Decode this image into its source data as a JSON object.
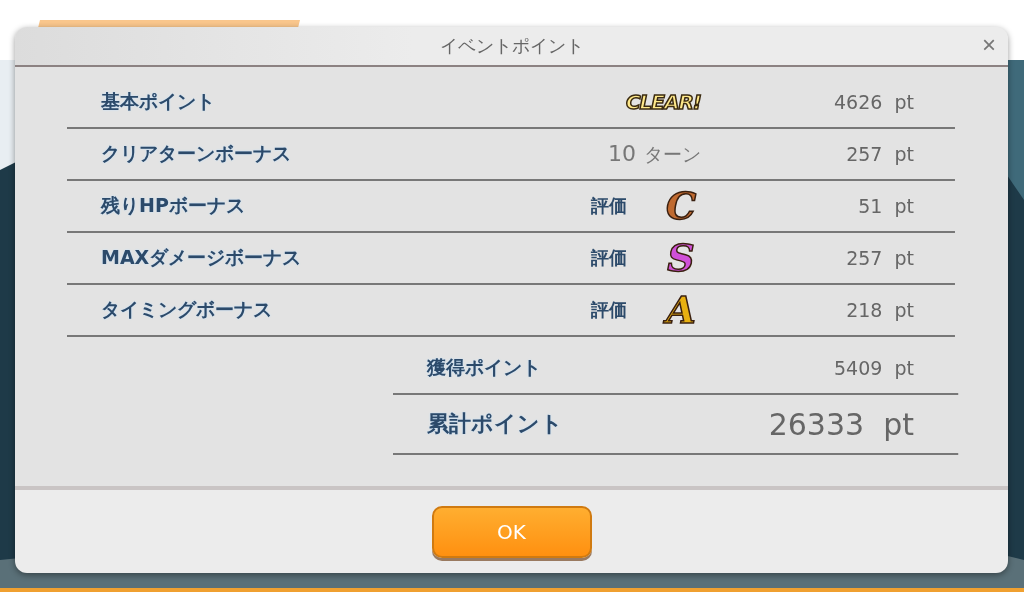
{
  "dialog": {
    "title": "イベントポイント",
    "close": "×"
  },
  "rows": [
    {
      "label": "基本ポイント",
      "kind": "badge",
      "badge": "CLEAR!",
      "points": "4626",
      "unit": "pt"
    },
    {
      "label": "クリアターンボーナス",
      "kind": "turns",
      "turns": "10",
      "turns_unit": "ターン",
      "points": "257",
      "unit": "pt"
    },
    {
      "label": "残りHPボーナス",
      "kind": "grade",
      "grade_label": "評価",
      "grade": "C",
      "color": "#c06a30",
      "points": "51",
      "unit": "pt"
    },
    {
      "label": "MAXダメージボーナス",
      "kind": "grade",
      "grade_label": "評価",
      "grade": "S",
      "color": "#d050d8",
      "points": "257",
      "unit": "pt"
    },
    {
      "label": "タイミングボーナス",
      "kind": "grade",
      "grade_label": "評価",
      "grade": "A",
      "color": "#e8b010",
      "points": "218",
      "unit": "pt"
    }
  ],
  "totals": [
    {
      "label": "獲得ポイント",
      "kind": "normal",
      "points": "5409",
      "unit": "pt"
    },
    {
      "label": "累計ポイント",
      "kind": "large",
      "points": "26333",
      "unit": "pt"
    }
  ],
  "buttons": [
    "OK"
  ]
}
